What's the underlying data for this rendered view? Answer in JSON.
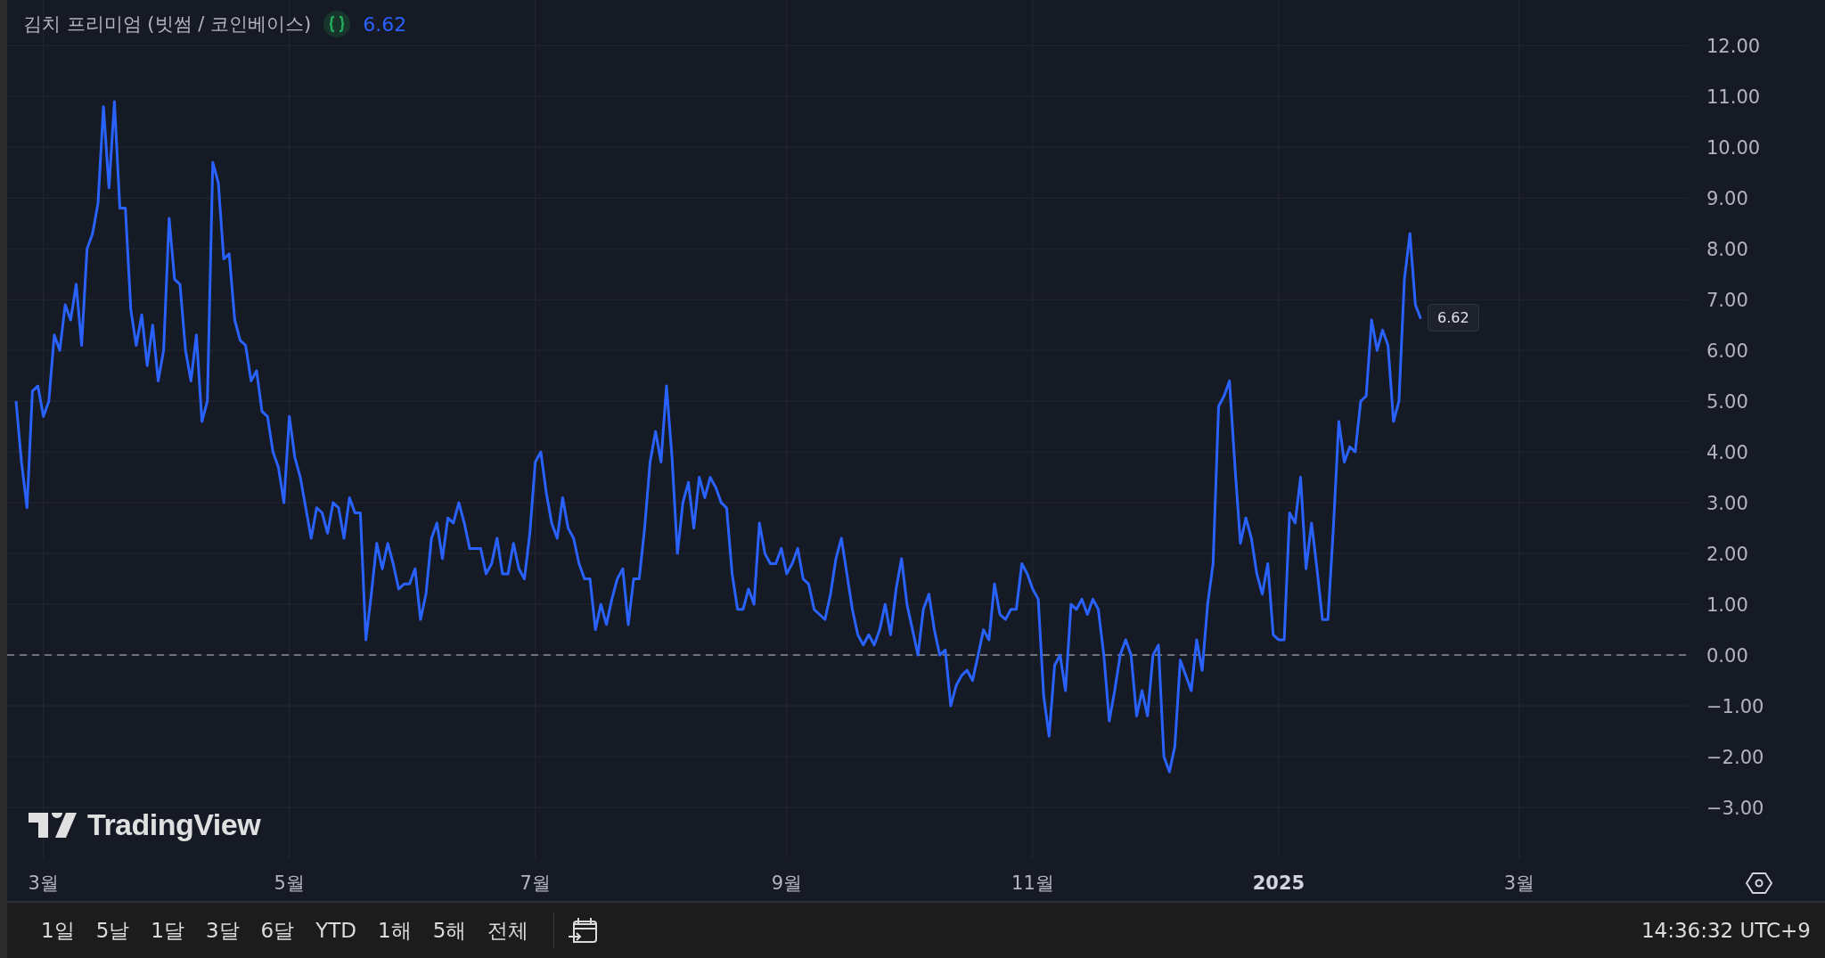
{
  "legend": {
    "value": "6.62"
  },
  "chart": {
    "chart_data": {
      "type": "line",
      "grid": true,
      "ylim": [
        -4,
        12.9
      ],
      "categories": [
        null,
        null,
        null,
        null,
        null,
        "3월",
        null,
        null,
        null,
        null,
        null,
        null,
        null,
        null,
        null,
        null,
        null,
        null,
        null,
        null,
        null,
        null,
        null,
        null,
        null,
        null,
        null,
        null,
        null,
        null,
        null,
        null,
        null,
        null,
        null,
        null,
        null,
        null,
        null,
        null,
        null,
        null,
        null,
        null,
        null,
        null,
        null,
        null,
        null,
        null,
        "5월",
        null,
        null,
        null,
        null,
        null,
        null,
        null,
        null,
        null,
        null,
        null,
        null,
        null,
        null,
        null,
        null,
        null,
        null,
        null,
        null,
        null,
        null,
        null,
        null,
        null,
        null,
        null,
        null,
        null,
        null,
        null,
        null,
        null,
        null,
        null,
        null,
        null,
        null,
        null,
        null,
        null,
        null,
        null,
        null,
        "7월",
        null,
        null,
        null,
        null,
        null,
        null,
        null,
        null,
        null,
        null,
        null,
        null,
        null,
        null,
        null,
        null,
        null,
        null,
        null,
        null,
        null,
        null,
        null,
        null,
        null,
        null,
        null,
        null,
        null,
        null,
        null,
        null,
        null,
        null,
        null,
        null,
        null,
        null,
        null,
        null,
        null,
        null,
        null,
        null,
        null,
        "9월",
        null,
        null,
        null,
        null,
        null,
        null,
        null,
        null,
        null,
        null,
        null,
        null,
        null,
        null,
        null,
        null,
        null,
        null,
        null,
        null,
        null,
        null,
        null,
        null,
        null,
        null,
        null,
        null,
        null,
        null,
        null,
        null,
        null,
        null,
        null,
        null,
        null,
        null,
        null,
        null,
        null,
        null,
        null,
        null,
        "11월",
        null,
        null,
        null,
        null,
        null,
        null,
        null,
        null,
        null,
        null,
        null,
        null,
        null,
        null,
        null,
        null,
        null,
        null,
        null,
        null,
        null,
        null,
        null,
        null,
        null,
        null,
        null,
        null,
        null,
        null,
        null,
        null,
        null,
        null,
        null,
        null,
        null,
        null,
        null,
        null,
        null,
        null,
        null,
        null,
        "2025",
        null,
        null,
        null,
        null,
        null,
        null,
        null,
        null,
        null,
        null,
        null,
        null,
        null,
        null,
        null,
        null,
        null,
        null,
        null,
        null,
        null,
        null,
        null,
        null,
        null,
        null,
        null,
        null,
        null,
        null,
        null,
        null,
        null,
        null,
        null,
        null,
        null,
        null,
        null,
        null,
        null,
        null,
        null,
        "3월",
        null,
        null,
        null,
        null,
        null,
        null,
        null,
        null,
        null,
        null,
        null,
        null,
        null,
        null,
        null,
        null,
        null,
        null,
        null,
        null,
        null,
        null,
        null,
        null,
        null,
        null,
        null,
        null,
        null,
        null,
        null
      ],
      "series": [
        {
          "name": "김치 프리미엄 (빗썸 / 코인베이스)",
          "color": "#2962ff",
          "values": [
            5.0,
            3.8,
            2.9,
            5.2,
            5.3,
            4.7,
            5.0,
            6.3,
            6.0,
            6.9,
            6.6,
            7.3,
            6.1,
            8.0,
            8.3,
            8.9,
            10.8,
            9.2,
            10.9,
            8.8,
            8.8,
            6.8,
            6.1,
            6.7,
            5.7,
            6.5,
            5.4,
            6.0,
            8.6,
            7.4,
            7.3,
            6.0,
            5.4,
            6.3,
            4.6,
            5.0,
            9.7,
            9.3,
            7.8,
            7.9,
            6.6,
            6.2,
            6.1,
            5.4,
            5.6,
            4.8,
            4.7,
            4.0,
            3.7,
            3.0,
            4.7,
            3.9,
            3.5,
            2.9,
            2.3,
            2.9,
            2.8,
            2.4,
            3.0,
            2.9,
            2.3,
            3.1,
            2.8,
            2.8,
            0.3,
            1.2,
            2.2,
            1.7,
            2.2,
            1.8,
            1.3,
            1.4,
            1.4,
            1.7,
            0.7,
            1.2,
            2.3,
            2.6,
            1.9,
            2.7,
            2.6,
            3.0,
            2.6,
            2.1,
            2.1,
            2.1,
            1.6,
            1.8,
            2.3,
            1.6,
            1.6,
            2.2,
            1.7,
            1.5,
            2.4,
            3.8,
            4.0,
            3.2,
            2.6,
            2.3,
            3.1,
            2.5,
            2.3,
            1.8,
            1.5,
            1.5,
            0.5,
            1.0,
            0.6,
            1.1,
            1.5,
            1.7,
            0.6,
            1.5,
            1.5,
            2.5,
            3.8,
            4.4,
            3.8,
            5.3,
            3.9,
            2.0,
            3.0,
            3.4,
            2.5,
            3.5,
            3.1,
            3.5,
            3.3,
            3.0,
            2.9,
            1.6,
            0.9,
            0.9,
            1.3,
            1.0,
            2.6,
            2.0,
            1.8,
            1.8,
            2.1,
            1.6,
            1.8,
            2.1,
            1.5,
            1.4,
            0.9,
            0.8,
            0.7,
            1.2,
            1.9,
            2.3,
            1.6,
            0.9,
            0.4,
            0.2,
            0.4,
            0.2,
            0.5,
            1.0,
            0.4,
            1.3,
            1.9,
            1.0,
            0.5,
            0.0,
            0.9,
            1.2,
            0.5,
            0.0,
            0.1,
            -1.0,
            -0.6,
            -0.4,
            -0.3,
            -0.5,
            0.0,
            0.5,
            0.3,
            1.4,
            0.8,
            0.7,
            0.9,
            0.9,
            1.8,
            1.6,
            1.3,
            1.1,
            -0.8,
            -1.6,
            -0.2,
            0.0,
            -0.7,
            1.0,
            0.9,
            1.1,
            0.8,
            1.1,
            0.9,
            0.0,
            -1.3,
            -0.7,
            0.0,
            0.3,
            0.0,
            -1.2,
            -0.7,
            -1.2,
            0.0,
            0.2,
            -2.0,
            -2.3,
            -1.8,
            -0.1,
            -0.4,
            -0.7,
            0.3,
            -0.3,
            1.0,
            1.8,
            4.9,
            5.1,
            5.4,
            3.7,
            2.2,
            2.7,
            2.3,
            1.6,
            1.2,
            1.8,
            0.4,
            0.3,
            0.3,
            2.8,
            2.6,
            3.5,
            1.7,
            2.6,
            1.7,
            0.7,
            0.7,
            2.5,
            4.6,
            3.8,
            4.1,
            4.0,
            5.0,
            5.1,
            6.6,
            6.0,
            6.4,
            6.1,
            4.6,
            5.0,
            7.4,
            8.3,
            6.9,
            6.62,
            null,
            null,
            null,
            null,
            null,
            null,
            null,
            null,
            null,
            null,
            null,
            null,
            null,
            null,
            null,
            null,
            null,
            null,
            null,
            null,
            null,
            null,
            null,
            null,
            null,
            null,
            null,
            null,
            null,
            null,
            null,
            null,
            null,
            null,
            null,
            null,
            null,
            null,
            null,
            null,
            null,
            null,
            null,
            null,
            null,
            null,
            null,
            null,
            null
          ]
        }
      ],
      "yticks": [
        {
          "value": 12,
          "label": "12.00"
        },
        {
          "value": 11,
          "label": "11.00"
        },
        {
          "value": 10,
          "label": "10.00"
        },
        {
          "value": 9,
          "label": "9.00"
        },
        {
          "value": 8,
          "label": "8.00"
        },
        {
          "value": 7,
          "label": "7.00"
        },
        {
          "value": 6,
          "label": "6.00"
        },
        {
          "value": 5,
          "label": "5.00"
        },
        {
          "value": 4,
          "label": "4.00"
        },
        {
          "value": 3,
          "label": "3.00"
        },
        {
          "value": 2,
          "label": "2.00"
        },
        {
          "value": 1,
          "label": "1.00"
        },
        {
          "value": 0,
          "label": "0.00"
        },
        {
          "value": -1,
          "label": "−1.00"
        },
        {
          "value": -2,
          "label": "−2.00"
        },
        {
          "value": -3,
          "label": "−3.00"
        }
      ],
      "ref_lines": [
        {
          "axis": "y",
          "value": 0
        }
      ]
    },
    "last_value_label": "6.62",
    "logo": "TradingView"
  },
  "range_buttons": [
    {
      "label": "1일"
    },
    {
      "label": "5날"
    },
    {
      "label": "1달"
    },
    {
      "label": "3달"
    },
    {
      "label": "6달"
    },
    {
      "label": "YTD"
    },
    {
      "label": "1해"
    },
    {
      "label": "5해"
    },
    {
      "label": "전체"
    }
  ],
  "time": "14:36:32 UTC+9"
}
